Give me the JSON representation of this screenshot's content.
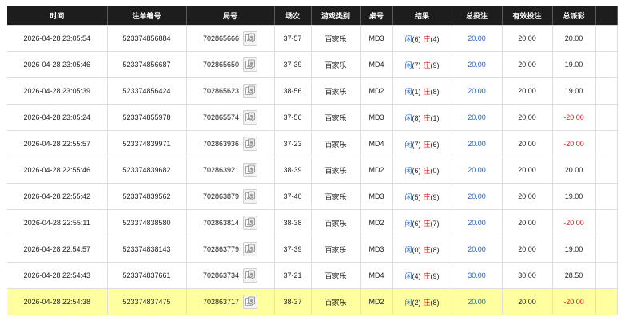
{
  "columns": {
    "time": "时间",
    "order_no": "注单编号",
    "round_no": "局号",
    "scene": "场次",
    "game_type": "游戏类别",
    "table_no": "桌号",
    "result": "结果",
    "total_bet": "总投注",
    "valid_bet": "有效投注",
    "payout": "总派彩"
  },
  "result_labels": {
    "player": "闲",
    "banker": "庄"
  },
  "colors": {
    "header_bg": "#1d1d1d",
    "player_blue": "#1c62d6",
    "banker_red": "#d81e1e",
    "highlight_row": "#ffffa0"
  },
  "icons": {
    "round_detail": "card-image-icon"
  },
  "rows": [
    {
      "time": "2026-04-28 23:05:54",
      "order": "523374856884",
      "round": "702865666",
      "scene": "37-57",
      "game": "百家乐",
      "table": "MD3",
      "player": "(6)",
      "banker": "(4)",
      "total": "20.00",
      "valid": "20.00",
      "payout": "20.00",
      "negative": false,
      "highlight": false
    },
    {
      "time": "2026-04-28 23:05:46",
      "order": "523374856687",
      "round": "702865650",
      "scene": "37-39",
      "game": "百家乐",
      "table": "MD4",
      "player": "(7)",
      "banker": "(9)",
      "total": "20.00",
      "valid": "20.00",
      "payout": "19.00",
      "negative": false,
      "highlight": false
    },
    {
      "time": "2026-04-28 23:05:39",
      "order": "523374856424",
      "round": "702865623",
      "scene": "38-56",
      "game": "百家乐",
      "table": "MD2",
      "player": "(1)",
      "banker": "(8)",
      "total": "20.00",
      "valid": "20.00",
      "payout": "19.00",
      "negative": false,
      "highlight": false
    },
    {
      "time": "2026-04-28 23:05:24",
      "order": "523374855978",
      "round": "702865574",
      "scene": "37-56",
      "game": "百家乐",
      "table": "MD3",
      "player": "(8)",
      "banker": "(1)",
      "total": "20.00",
      "valid": "20.00",
      "payout": "-20.00",
      "negative": true,
      "highlight": false
    },
    {
      "time": "2026-04-28 22:55:57",
      "order": "523374839971",
      "round": "702863936",
      "scene": "37-23",
      "game": "百家乐",
      "table": "MD4",
      "player": "(7)",
      "banker": "(6)",
      "total": "20.00",
      "valid": "20.00",
      "payout": "-20.00",
      "negative": true,
      "highlight": false
    },
    {
      "time": "2026-04-28 22:55:46",
      "order": "523374839682",
      "round": "702863921",
      "scene": "38-39",
      "game": "百家乐",
      "table": "MD2",
      "player": "(6)",
      "banker": "(0)",
      "total": "20.00",
      "valid": "20.00",
      "payout": "20.00",
      "negative": false,
      "highlight": false
    },
    {
      "time": "2026-04-28 22:55:42",
      "order": "523374839562",
      "round": "702863879",
      "scene": "37-40",
      "game": "百家乐",
      "table": "MD3",
      "player": "(5)",
      "banker": "(9)",
      "total": "20.00",
      "valid": "20.00",
      "payout": "19.00",
      "negative": false,
      "highlight": false
    },
    {
      "time": "2026-04-28 22:55:11",
      "order": "523374838580",
      "round": "702863814",
      "scene": "38-38",
      "game": "百家乐",
      "table": "MD2",
      "player": "(6)",
      "banker": "(7)",
      "total": "20.00",
      "valid": "20.00",
      "payout": "-20.00",
      "negative": true,
      "highlight": false
    },
    {
      "time": "2026-04-28 22:54:57",
      "order": "523374838143",
      "round": "702863779",
      "scene": "37-39",
      "game": "百家乐",
      "table": "MD3",
      "player": "(0)",
      "banker": "(8)",
      "total": "20.00",
      "valid": "20.00",
      "payout": "19.00",
      "negative": false,
      "highlight": false
    },
    {
      "time": "2026-04-28 22:54:43",
      "order": "523374837661",
      "round": "702863734",
      "scene": "37-21",
      "game": "百家乐",
      "table": "MD4",
      "player": "(4)",
      "banker": "(9)",
      "total": "30.00",
      "valid": "30.00",
      "payout": "28.50",
      "negative": false,
      "highlight": false
    },
    {
      "time": "2026-04-28 22:54:38",
      "order": "523374837475",
      "round": "702863717",
      "scene": "38-37",
      "game": "百家乐",
      "table": "MD2",
      "player": "(2)",
      "banker": "(8)",
      "total": "20.00",
      "valid": "20.00",
      "payout": "-20.00",
      "negative": true,
      "highlight": true
    }
  ]
}
